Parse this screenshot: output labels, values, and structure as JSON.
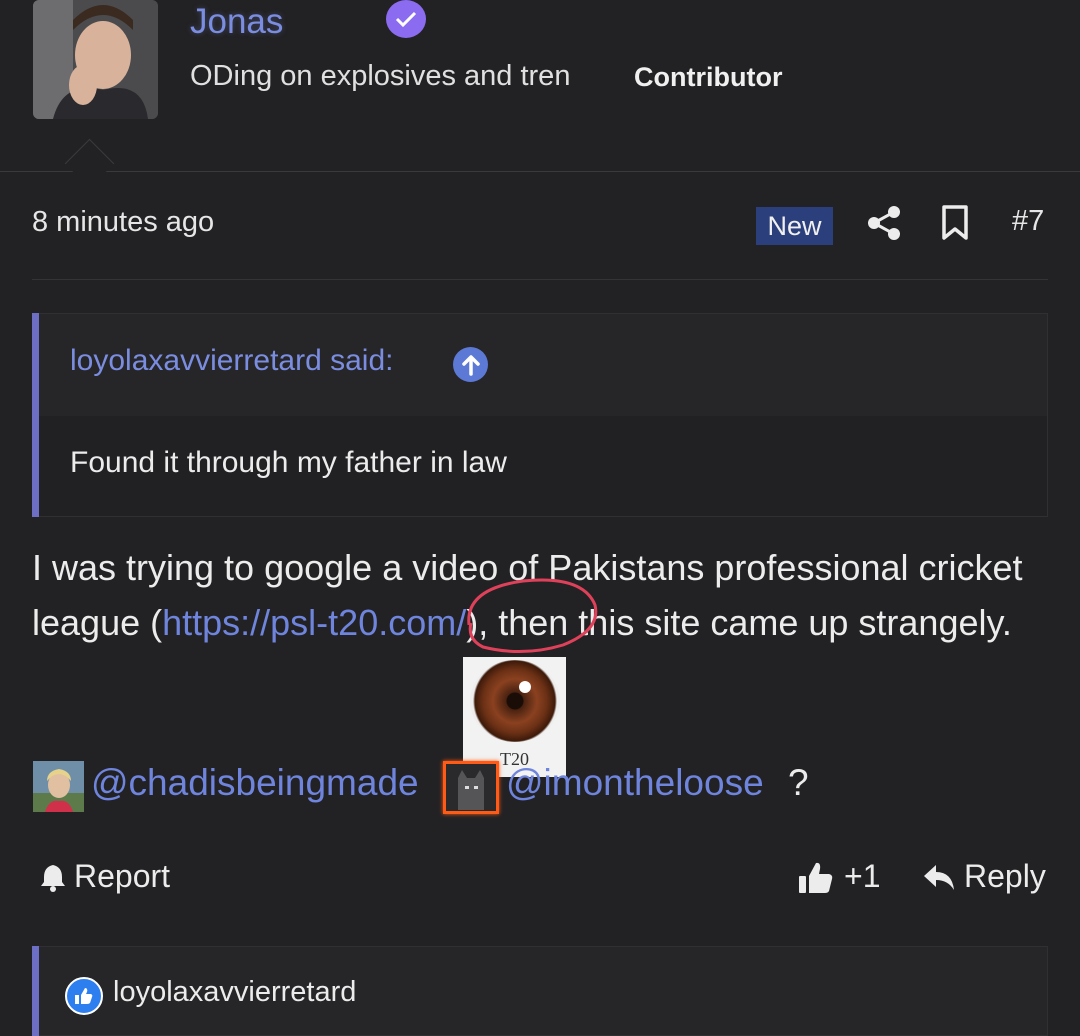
{
  "user": {
    "name": "Jonas",
    "title": "ODing on explosives and tren",
    "banner": "Contributor"
  },
  "post": {
    "timestamp": "8 minutes ago",
    "new_badge": "New",
    "number": "#7"
  },
  "quote": {
    "attribution": "loyolaxavvierretard said:",
    "text": "Found it through my father in law"
  },
  "body": {
    "text_before": "I was trying to google a video of Pakistans professional cricket league (",
    "link": "https://psl-t20.com/",
    "text_after": "), then this site came up strangely."
  },
  "sticker": {
    "caption": "T20"
  },
  "mentions": {
    "first": "@chadisbeingmade",
    "second": "@imontheloose",
    "suffix": "?"
  },
  "actions": {
    "report": "Report",
    "like_count": "+1",
    "reply": "Reply"
  },
  "reactions": {
    "user": "loyolaxavvierretard"
  },
  "colors": {
    "accent": "#7b8de0",
    "badge": "#2b3f7c",
    "highlight": "#ff5a16"
  }
}
